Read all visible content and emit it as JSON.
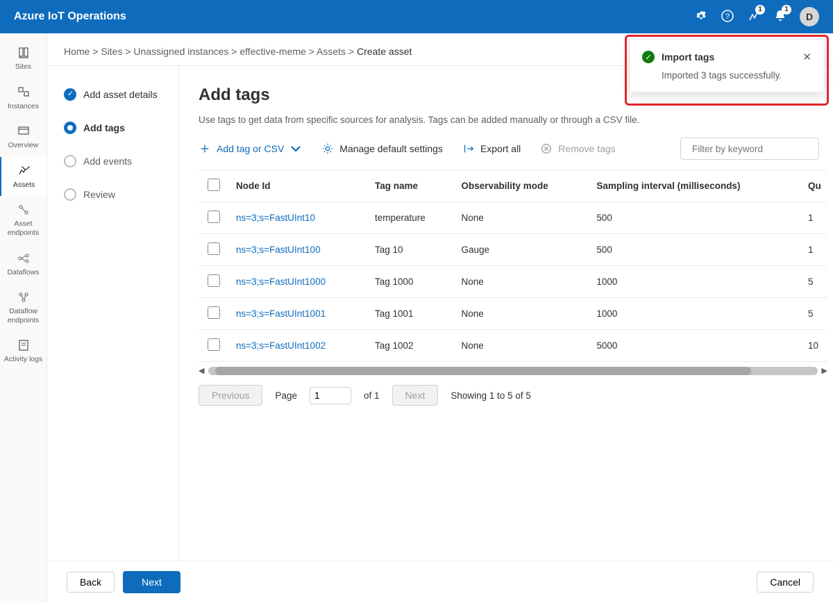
{
  "header": {
    "app_title": "Azure IoT Operations",
    "badge1": "1",
    "badge2": "1",
    "avatar": "D"
  },
  "rail": {
    "items": [
      {
        "label": "Sites",
        "icon": "book"
      },
      {
        "label": "Instances",
        "icon": "grid"
      },
      {
        "label": "Overview",
        "icon": "panel"
      },
      {
        "label": "Assets",
        "icon": "assets",
        "active": true
      },
      {
        "label": "Asset endpoints",
        "icon": "endpoints"
      },
      {
        "label": "Dataflows",
        "icon": "dataflows"
      },
      {
        "label": "Dataflow endpoints",
        "icon": "dfendpoints"
      },
      {
        "label": "Activity logs",
        "icon": "logs"
      }
    ]
  },
  "breadcrumb": {
    "items": [
      "Home",
      "Sites",
      "Unassigned instances",
      "effective-meme",
      "Assets"
    ],
    "current": "Create asset"
  },
  "wizard": {
    "steps": [
      {
        "label": "Add asset details",
        "state": "done"
      },
      {
        "label": "Add tags",
        "state": "active"
      },
      {
        "label": "Add events",
        "state": "pending"
      },
      {
        "label": "Review",
        "state": "pending"
      }
    ]
  },
  "page": {
    "title": "Add tags",
    "desc": "Use tags to get data from specific sources for analysis. Tags can be added manually or through a CSV file."
  },
  "toolbar": {
    "add_label": "Add tag or CSV",
    "manage_label": "Manage default settings",
    "export_label": "Export all",
    "remove_label": "Remove tags",
    "filter_placeholder": "Filter by keyword"
  },
  "table": {
    "columns": [
      "Node Id",
      "Tag name",
      "Observability mode",
      "Sampling interval (milliseconds)",
      "Qu"
    ],
    "rows": [
      {
        "node": "ns=3;s=FastUInt10",
        "tag": "temperature",
        "mode": "None",
        "interval": "500",
        "q": "1"
      },
      {
        "node": "ns=3;s=FastUInt100",
        "tag": "Tag 10",
        "mode": "Gauge",
        "interval": "500",
        "q": "1"
      },
      {
        "node": "ns=3;s=FastUInt1000",
        "tag": "Tag 1000",
        "mode": "None",
        "interval": "1000",
        "q": "5"
      },
      {
        "node": "ns=3;s=FastUInt1001",
        "tag": "Tag 1001",
        "mode": "None",
        "interval": "1000",
        "q": "5"
      },
      {
        "node": "ns=3;s=FastUInt1002",
        "tag": "Tag 1002",
        "mode": "None",
        "interval": "5000",
        "q": "10"
      }
    ]
  },
  "pager": {
    "previous": "Previous",
    "page_label": "Page",
    "page_value": "1",
    "of_label": "of 1",
    "next": "Next",
    "showing": "Showing 1 to 5 of 5"
  },
  "footer": {
    "back": "Back",
    "next": "Next",
    "cancel": "Cancel"
  },
  "toast": {
    "title": "Import tags",
    "body": "Imported 3 tags successfully."
  }
}
